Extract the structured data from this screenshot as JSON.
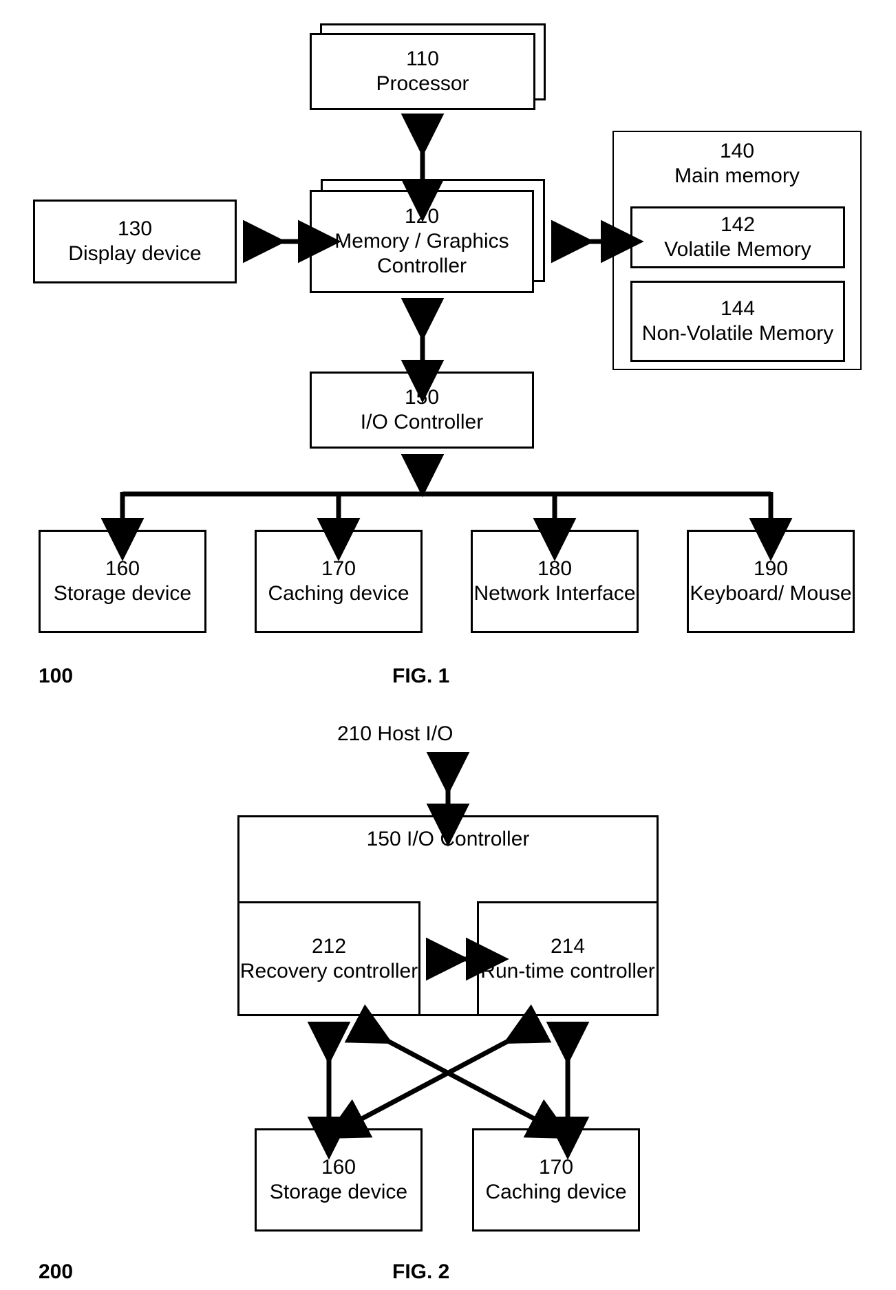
{
  "fig1": {
    "ref": "100",
    "caption": "FIG. 1",
    "processor": {
      "num": "110",
      "label": "Processor"
    },
    "memgfx": {
      "num": "120",
      "label": "Memory / Graphics Controller"
    },
    "display": {
      "num": "130",
      "label": "Display device"
    },
    "mainmem": {
      "num": "140",
      "label": "Main memory"
    },
    "volmem": {
      "num": "142",
      "label": "Volatile Memory"
    },
    "nvolmem": {
      "num": "144",
      "label": "Non-Volatile Memory"
    },
    "ioctrl": {
      "num": "150",
      "label": "I/O Controller"
    },
    "storage": {
      "num": "160",
      "label": "Storage device"
    },
    "caching": {
      "num": "170",
      "label": "Caching device"
    },
    "netif": {
      "num": "180",
      "label": "Network Interface"
    },
    "kbmouse": {
      "num": "190",
      "label": "Keyboard/ Mouse"
    }
  },
  "fig2": {
    "ref": "200",
    "caption": "FIG. 2",
    "hostio": {
      "num": "210",
      "label": "Host I/O"
    },
    "ioctrl": {
      "num": "150",
      "label": "I/O Controller"
    },
    "recovery": {
      "num": "212",
      "label": "Recovery controller"
    },
    "runtime": {
      "num": "214",
      "label": "Run-time controller"
    },
    "storage": {
      "num": "160",
      "label": "Storage device"
    },
    "caching": {
      "num": "170",
      "label": "Caching device"
    }
  }
}
